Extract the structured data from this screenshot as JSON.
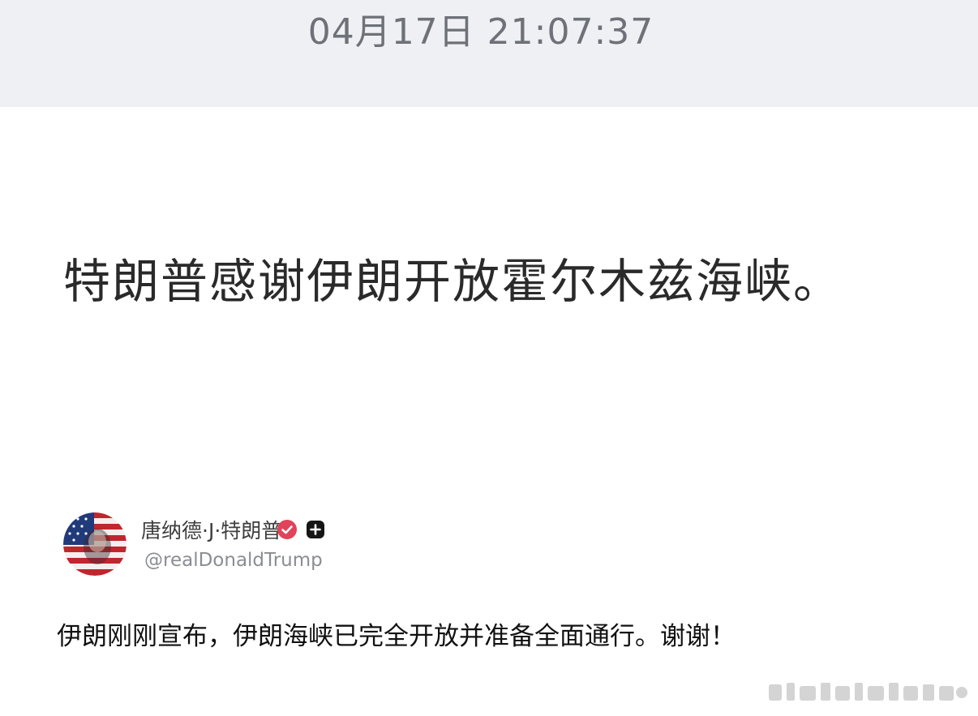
{
  "header": {
    "timestamp": "04月17日 21:07:37"
  },
  "headline": "特朗普感谢伊朗开放霍尔木兹海峡。",
  "author": {
    "name": "唐纳德·J·特朗普",
    "handle": "@realDonaldTrump",
    "avatar_icon": "flag-portrait-avatar",
    "verified_icon": "verified-badge-icon",
    "plus_icon": "plus-badge-icon",
    "verified_color": "#e0435a"
  },
  "post": {
    "text": "伊朗刚刚宣布，伊朗海峡已完全开放并准备全面通行。谢谢！"
  },
  "colors": {
    "top_bar_bg": "#eef0f3",
    "timestamp_text": "#6e7178",
    "headline_text": "#2a2a2a",
    "handle_text": "#8b8d93"
  }
}
